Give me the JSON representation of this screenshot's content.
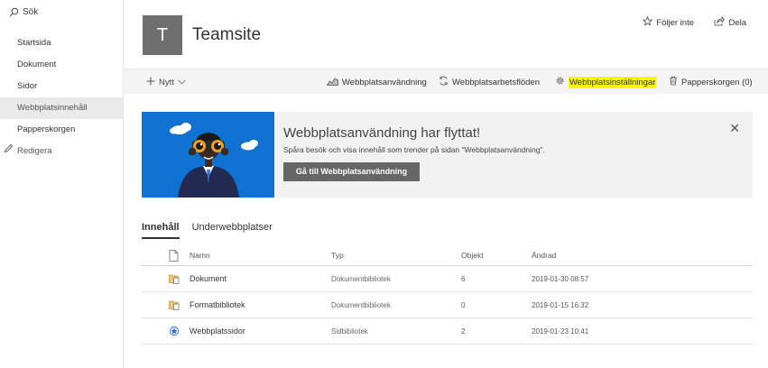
{
  "search": {
    "label": "Sök"
  },
  "nav": {
    "items": [
      {
        "label": "Startsida"
      },
      {
        "label": "Dokument"
      },
      {
        "label": "Sidor"
      },
      {
        "label": "Webbplatsinnehåll"
      },
      {
        "label": "Papperskorgen"
      }
    ],
    "selected_index": 3,
    "edit_label": "Redigera"
  },
  "site": {
    "logo_letter": "T",
    "title": "Teamsite",
    "follow_label": "Följer inte",
    "share_label": "Dela"
  },
  "commandbar": {
    "new_label": "Nytt",
    "usage_label": "Webbplatsanvändning",
    "workflows_label": "Webbplatsarbetsflöden",
    "settings_label": "Webbplatsinställningar",
    "recycle_label": "Papperskorgen (0)"
  },
  "banner": {
    "title": "Webbplatsanvändning har flyttat!",
    "text": "Spåra besök och visa innehåll som trender på sidan \"Webbplatsanvändning\".",
    "button_label": "Gå till Webbplatsanvändning",
    "close_glyph": "✕"
  },
  "tabs": [
    {
      "label": "Innehåll"
    },
    {
      "label": "Underwebbplatser"
    }
  ],
  "table": {
    "headers": {
      "name": "Namn",
      "type": "Typ",
      "count": "Objekt",
      "modified": "Ändrad"
    },
    "rows": [
      {
        "icon": "document-library-icon",
        "name": "Dokument",
        "type": "Dokumentbibliotek",
        "count": "6",
        "modified": "2019-01-30 08:57"
      },
      {
        "icon": "document-library-icon",
        "name": "Formatbibliotek",
        "type": "Dokumentbibliotek",
        "count": "0",
        "modified": "2019-01-15 16:32"
      },
      {
        "icon": "site-pages-icon",
        "name": "Webbplatssidor",
        "type": "Sidbibliotek",
        "count": "2",
        "modified": "2019-01-23 10:41"
      }
    ]
  },
  "colors": {
    "banner_blue": "#0f72d0",
    "highlight_yellow": "#f6f612",
    "button_gray": "#666666",
    "logo_gray": "#6e6e6e"
  }
}
